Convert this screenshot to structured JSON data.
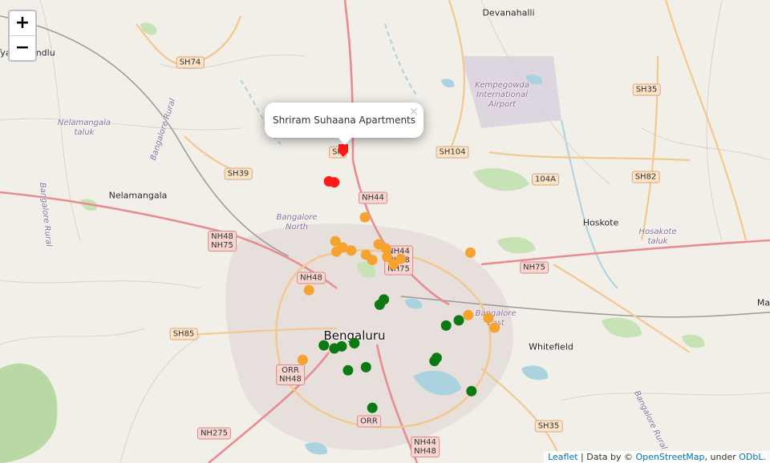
{
  "zoom": {
    "in_label": "+",
    "out_label": "−"
  },
  "popup": {
    "text": "Shriram Suhaana Apartments",
    "close_label": "×"
  },
  "attribution": {
    "leaflet": "Leaflet",
    "sep": " | Data by © ",
    "osm": "OpenStreetMap",
    "tail": ", under ",
    "odbl": "ODbL."
  },
  "colors": {
    "red": "#ff1a1a",
    "orange": "#f5a32e",
    "green": "#0c7a12",
    "land": "#f2efe9"
  },
  "places": [
    {
      "id": "devanahalli",
      "label": "Devanahalli",
      "kind": "town"
    },
    {
      "id": "tyamagondlu",
      "label": "Tyamagondlu",
      "kind": "town"
    },
    {
      "id": "nelamangala",
      "label": "Nelamangala",
      "kind": "town"
    },
    {
      "id": "hoskote",
      "label": "Hoskote",
      "kind": "town"
    },
    {
      "id": "whitefield",
      "label": "Whitefield",
      "kind": "town"
    },
    {
      "id": "bengaluru",
      "label": "Bengaluru",
      "kind": "city"
    },
    {
      "id": "ma",
      "label": "Ma",
      "kind": "town"
    },
    {
      "id": "airport",
      "label": "Kempegowda\nInternational\nAirport",
      "kind": "region"
    },
    {
      "id": "nelamangala-taluk",
      "label": "Nelamangala\ntaluk",
      "kind": "region"
    },
    {
      "id": "bangalore-rural-w",
      "label": "Bangalore Rural",
      "kind": "region"
    },
    {
      "id": "bangalore-rural-nw",
      "label": "Bangalore Rural",
      "kind": "region"
    },
    {
      "id": "bangalore-north",
      "label": "Bangalore\nNorth",
      "kind": "region"
    },
    {
      "id": "hosakote-taluk",
      "label": "Hosakote\ntaluk",
      "kind": "region"
    },
    {
      "id": "bangalore-east",
      "label": "Bangalore\nEast",
      "kind": "region"
    },
    {
      "id": "bangalore-rural-se",
      "label": "Bangalore Rural",
      "kind": "region"
    }
  ],
  "shields": [
    {
      "id": "sh74",
      "lines": [
        "SH74"
      ],
      "kind": "sh"
    },
    {
      "id": "sh35-ne",
      "lines": [
        "SH35"
      ],
      "kind": "sh"
    },
    {
      "id": "sh104",
      "lines": [
        "SH104"
      ],
      "kind": "sh"
    },
    {
      "id": "sh39",
      "lines": [
        "SH39"
      ],
      "kind": "sh"
    },
    {
      "id": "104a",
      "lines": [
        "104A"
      ],
      "kind": "sh"
    },
    {
      "id": "sh82",
      "lines": [
        "SH82"
      ],
      "kind": "sh"
    },
    {
      "id": "sh-popup",
      "lines": [
        "SH"
      ],
      "kind": "sh"
    },
    {
      "id": "nh44-n",
      "lines": [
        "NH44"
      ],
      "kind": "nh"
    },
    {
      "id": "nh48-nh75",
      "lines": [
        "NH48",
        "NH75"
      ],
      "kind": "nh"
    },
    {
      "id": "nh44-nh48-nh75",
      "lines": [
        "NH44",
        "NH48",
        "NH75"
      ],
      "kind": "nh"
    },
    {
      "id": "nh75-e",
      "lines": [
        "NH75"
      ],
      "kind": "nh"
    },
    {
      "id": "nh48-c",
      "lines": [
        "NH48"
      ],
      "kind": "nh"
    },
    {
      "id": "sh85",
      "lines": [
        "SH85"
      ],
      "kind": "sh"
    },
    {
      "id": "orr-nh48",
      "lines": [
        "ORR",
        "NH48"
      ],
      "kind": "nh"
    },
    {
      "id": "orr-s",
      "lines": [
        "ORR"
      ],
      "kind": "nh"
    },
    {
      "id": "nh275",
      "lines": [
        "NH275"
      ],
      "kind": "nh"
    },
    {
      "id": "nh44-nh48-s",
      "lines": [
        "NH44",
        "NH48"
      ],
      "kind": "nh"
    },
    {
      "id": "sh35-se",
      "lines": [
        "SH35"
      ],
      "kind": "sh"
    }
  ],
  "markers": [
    {
      "lat": 13.201,
      "lng": 77.5855,
      "color": "red",
      "shape": "pin"
    },
    {
      "lat": 13.1715,
      "lng": 77.572,
      "color": "red",
      "shape": "circle"
    },
    {
      "lat": 13.1705,
      "lng": 77.577,
      "color": "red",
      "shape": "circle"
    },
    {
      "lat": 13.137,
      "lng": 77.606,
      "color": "orange",
      "shape": "circle"
    },
    {
      "lat": 13.114,
      "lng": 77.578,
      "color": "orange",
      "shape": "circle"
    },
    {
      "lat": 13.108,
      "lng": 77.585,
      "color": "orange",
      "shape": "circle"
    },
    {
      "lat": 13.104,
      "lng": 77.579,
      "color": "orange",
      "shape": "circle"
    },
    {
      "lat": 13.105,
      "lng": 77.593,
      "color": "orange",
      "shape": "circle"
    },
    {
      "lat": 13.101,
      "lng": 77.607,
      "color": "orange",
      "shape": "circle"
    },
    {
      "lat": 13.111,
      "lng": 77.619,
      "color": "orange",
      "shape": "circle"
    },
    {
      "lat": 13.107,
      "lng": 77.626,
      "color": "orange",
      "shape": "circle"
    },
    {
      "lat": 13.099,
      "lng": 77.627,
      "color": "orange",
      "shape": "circle"
    },
    {
      "lat": 13.097,
      "lng": 77.64,
      "color": "orange",
      "shape": "circle"
    },
    {
      "lat": 13.096,
      "lng": 77.613,
      "color": "orange",
      "shape": "circle"
    },
    {
      "lat": 13.092,
      "lng": 77.633,
      "color": "orange",
      "shape": "circle"
    },
    {
      "lat": 13.103,
      "lng": 77.706,
      "color": "orange",
      "shape": "circle"
    },
    {
      "lat": 13.067,
      "lng": 77.553,
      "color": "orange",
      "shape": "circle"
    },
    {
      "lat": 13.043,
      "lng": 77.704,
      "color": "orange",
      "shape": "circle"
    },
    {
      "lat": 13.04,
      "lng": 77.723,
      "color": "orange",
      "shape": "circle"
    },
    {
      "lat": 13.031,
      "lng": 77.729,
      "color": "orange",
      "shape": "circle"
    },
    {
      "lat": 13.0,
      "lng": 77.547,
      "color": "orange",
      "shape": "circle"
    },
    {
      "lat": 13.058,
      "lng": 77.624,
      "color": "green",
      "shape": "circle"
    },
    {
      "lat": 13.053,
      "lng": 77.62,
      "color": "green",
      "shape": "circle"
    },
    {
      "lat": 13.033,
      "lng": 77.683,
      "color": "green",
      "shape": "circle"
    },
    {
      "lat": 13.038,
      "lng": 77.695,
      "color": "green",
      "shape": "circle"
    },
    {
      "lat": 13.014,
      "lng": 77.567,
      "color": "green",
      "shape": "circle"
    },
    {
      "lat": 13.011,
      "lng": 77.577,
      "color": "green",
      "shape": "circle"
    },
    {
      "lat": 13.013,
      "lng": 77.584,
      "color": "green",
      "shape": "circle"
    },
    {
      "lat": 13.016,
      "lng": 77.596,
      "color": "green",
      "shape": "circle"
    },
    {
      "lat": 13.002,
      "lng": 77.674,
      "color": "green",
      "shape": "circle"
    },
    {
      "lat": 12.999,
      "lng": 77.672,
      "color": "green",
      "shape": "circle"
    },
    {
      "lat": 12.993,
      "lng": 77.607,
      "color": "green",
      "shape": "circle"
    },
    {
      "lat": 12.99,
      "lng": 77.59,
      "color": "green",
      "shape": "circle"
    },
    {
      "lat": 12.97,
      "lng": 77.707,
      "color": "green",
      "shape": "circle"
    },
    {
      "lat": 12.954,
      "lng": 77.613,
      "color": "green",
      "shape": "circle"
    }
  ]
}
